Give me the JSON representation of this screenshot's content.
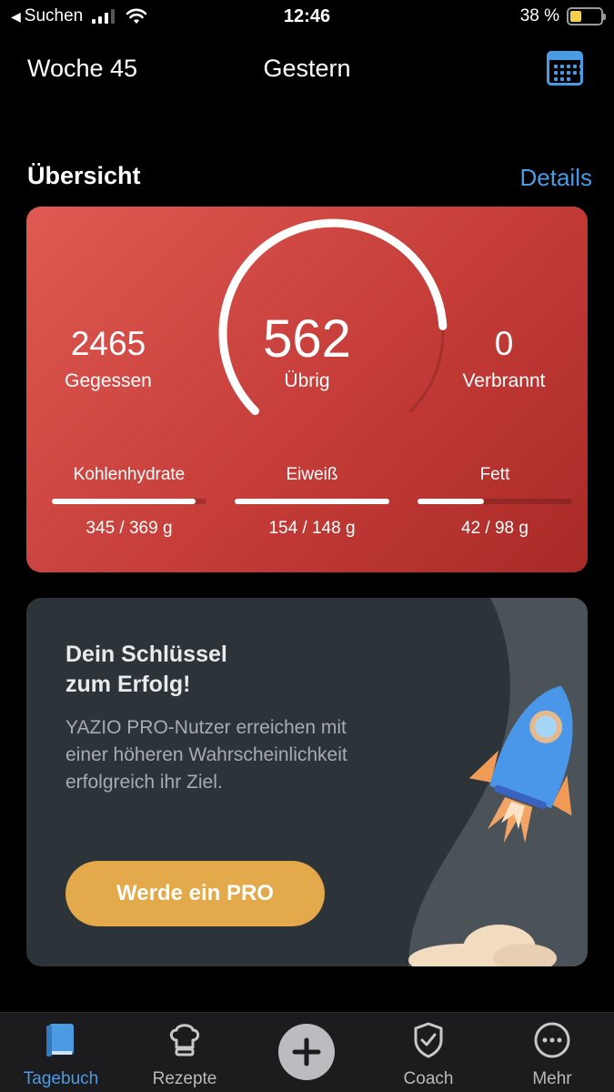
{
  "status_bar": {
    "back_label": "Suchen",
    "time": "12:46",
    "battery": "38 %",
    "battery_level": 0.38,
    "signal_bars": 3
  },
  "header": {
    "week": "Woche 45",
    "day": "Gestern",
    "calendar_icon": "calendar-icon"
  },
  "overview": {
    "title": "Übersicht",
    "details_link": "Details"
  },
  "summary": {
    "eaten_value": "2465",
    "eaten_label": "Gegessen",
    "remaining_value": "562",
    "remaining_label": "Übrig",
    "burned_value": "0",
    "burned_label": "Verbrannt",
    "gauge_progress": 0.82,
    "accent_color": "#d2463f",
    "macros": [
      {
        "name": "Kohlenhydrate",
        "amount": "345 / 369 g",
        "progress": 0.93
      },
      {
        "name": "Eiweiß",
        "amount": "154 / 148 g",
        "progress": 1.0
      },
      {
        "name": "Fett",
        "amount": "42 / 98 g",
        "progress": 0.43
      }
    ]
  },
  "promo": {
    "title_line1": "Dein Schlüssel",
    "title_line2": "zum Erfolg!",
    "text": "YAZIO PRO-Nutzer erreichen mit einer höheren Wahrscheinlichkeit erfolgreich ihr Ziel.",
    "button": "Werde ein PRO",
    "button_color": "#e3a94a"
  },
  "tabbar": {
    "tabs": [
      {
        "label": "Tagebuch",
        "icon": "book-icon",
        "active": true
      },
      {
        "label": "Rezepte",
        "icon": "chef-hat-icon",
        "active": false
      },
      {
        "label": "",
        "icon": "plus-icon",
        "active": false
      },
      {
        "label": "Coach",
        "icon": "shield-check-icon",
        "active": false
      },
      {
        "label": "Mehr",
        "icon": "more-icon",
        "active": false
      }
    ],
    "active_color": "#4a9be3"
  }
}
